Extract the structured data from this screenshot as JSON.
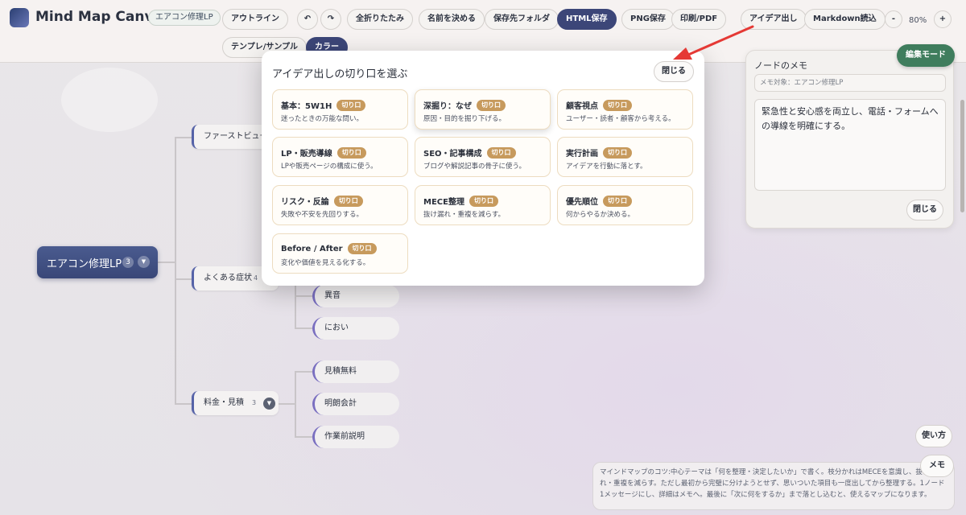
{
  "app": {
    "title": "Mind Map Canvas",
    "file_tag": "エアコン修理LP"
  },
  "toolbar": {
    "outline": "アウトライン",
    "undo_icon": "↶",
    "redo_icon": "↷",
    "collapse_all": "全折りたたみ",
    "name": "名前を決める",
    "save_folder": "保存先フォルダ",
    "html_save": "HTML保存",
    "png_save": "PNG保存",
    "print_pdf": "印刷/PDF",
    "ideas": "アイデア出し",
    "markdown": "Markdown読込",
    "zoom_out": "-",
    "zoom_level": "80%",
    "zoom_in": "+",
    "template": "テンプレ/サンプル",
    "color": "カラー"
  },
  "mindmap": {
    "root": {
      "label": "エアコン修理LP",
      "count": "3",
      "toggle": "▼"
    },
    "branches": [
      {
        "label": "ファーストビュー"
      },
      {
        "label": "よくある症状",
        "count": "4"
      },
      {
        "label": "料金・見積",
        "count": "3",
        "toggle": "▼"
      }
    ],
    "leaves": [
      "異音",
      "におい",
      "見積無料",
      "明朗会計",
      "作業前説明"
    ]
  },
  "modal": {
    "title": "アイデア出しの切り口を選ぶ",
    "close": "閉じる",
    "cards": [
      {
        "title": "基本：5W1H",
        "tag": "切り口",
        "desc": "迷ったときの万能な問い。"
      },
      {
        "title": "深掘り：なぜ",
        "tag": "切り口",
        "desc": "原因・目的を掘り下げる。"
      },
      {
        "title": "顧客視点",
        "tag": "切り口",
        "desc": "ユーザー・読者・顧客から考える。"
      },
      {
        "title": "LP・販売導線",
        "tag": "切り口",
        "desc": "LPや販売ページの構成に使う。"
      },
      {
        "title": "SEO・記事構成",
        "tag": "切り口",
        "desc": "ブログや解説記事の骨子に使う。"
      },
      {
        "title": "実行計画",
        "tag": "切り口",
        "desc": "アイデアを行動に落とす。"
      },
      {
        "title": "リスク・反論",
        "tag": "切り口",
        "desc": "失敗や不安を先回りする。"
      },
      {
        "title": "MECE整理",
        "tag": "切り口",
        "desc": "抜け漏れ・重複を減らす。"
      },
      {
        "title": "優先順位",
        "tag": "切り口",
        "desc": "何からやるか決める。"
      },
      {
        "title": "Before / After",
        "tag": "切り口",
        "desc": "変化や価値を見える化する。"
      }
    ]
  },
  "memo": {
    "title": "ノードのメモ",
    "target": "メモ対象：エアコン修理LP",
    "text": "緊急性と安心感を両立し、電話・フォームへの導線を明確にする。",
    "close": "閉じる",
    "edit_mode": "編集モード"
  },
  "footer": {
    "help": "使い方",
    "memo": "メモ",
    "tips": "マインドマップのコツ:中心テーマは「何を整理・決定したいか」で書く。枝分かれはMECEを意識し、抜け漏れ・重複を減らす。ただし最初から完璧に分けようとせず、思いついた項目も一度出してから整理する。1ノード1メッセージにし、詳細はメモへ。最後に「次に何をするか」まで落とし込むと、使えるマップになります。"
  },
  "colors": {
    "accent_dark": "#3c4678",
    "edit_mode": "#3f7d5d",
    "tag": "#c79a5d",
    "annotation_arrow": "#e53935"
  }
}
